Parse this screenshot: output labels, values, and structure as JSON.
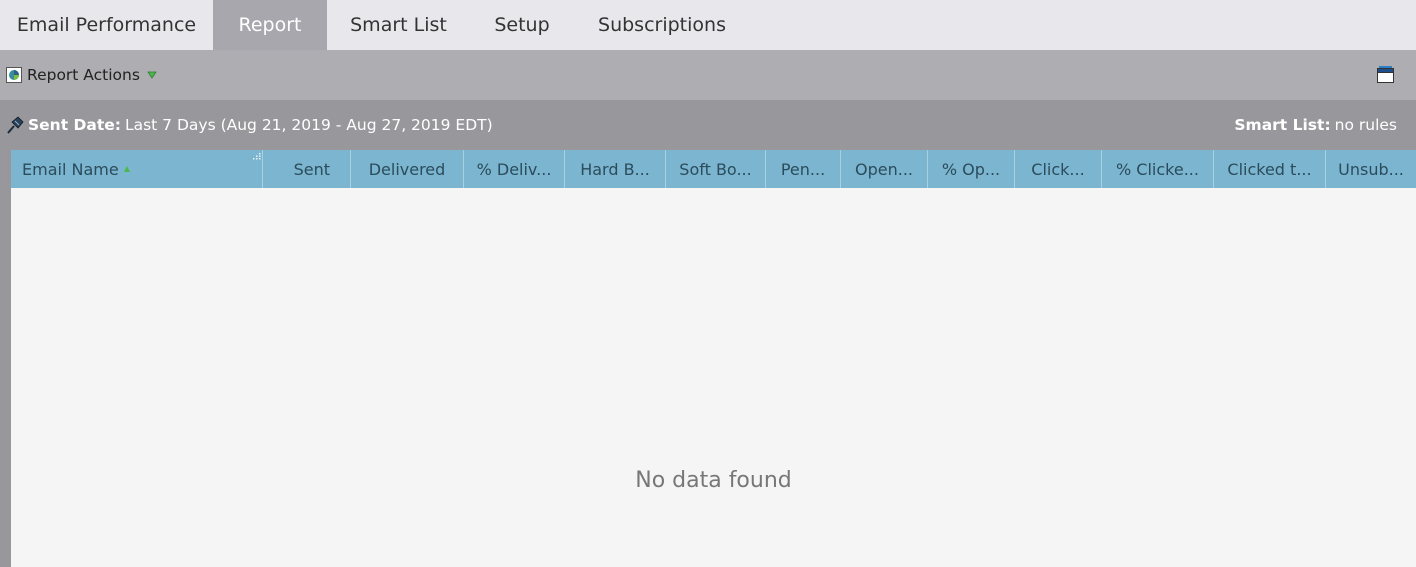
{
  "tabs": [
    {
      "label": "Email Performance",
      "active": false
    },
    {
      "label": "Report",
      "active": true
    },
    {
      "label": "Smart List",
      "active": false
    },
    {
      "label": "Setup",
      "active": false
    },
    {
      "label": "Subscriptions",
      "active": false
    }
  ],
  "toolbar": {
    "report_actions_label": "Report Actions",
    "report_actions_icon": "report-icon",
    "caret_icon": "caret-down-icon",
    "window_icon": "window-icon"
  },
  "filter": {
    "sent_date_label": "Sent Date:",
    "sent_date_value": "Last 7 Days (Aug 21, 2019 - Aug 27, 2019 EDT)",
    "smart_list_label": "Smart List:",
    "smart_list_value": "no rules"
  },
  "grid": {
    "columns": [
      "Email Name",
      "Sent",
      "Delivered",
      "% Deliv...",
      "Hard B...",
      "Soft Bo...",
      "Pen...",
      "Open...",
      "% Op...",
      "Click...",
      "% Clicke...",
      "Clicked t...",
      "Unsub..."
    ],
    "sorted_column": "Email Name",
    "sort_direction": "ascending",
    "empty_message": "No data found"
  },
  "colors": {
    "tab_active_bg": "#a8a7ad",
    "toolbar_bg": "#aeadb2",
    "filter_bg": "#98979c",
    "grid_header_bg": "#7bb5cf"
  }
}
